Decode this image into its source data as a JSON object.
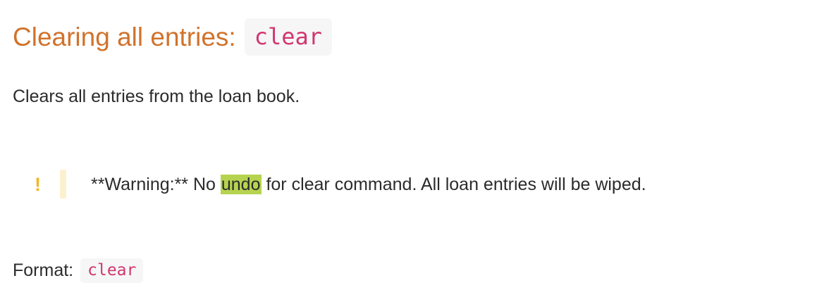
{
  "section": {
    "heading_text": "Clearing all entries:",
    "heading_code": "clear",
    "description": "Clears all entries from the loan book."
  },
  "warning": {
    "icon": "!",
    "icon_name": "exclamation-icon",
    "text_before": "**Warning:** No ",
    "highlighted": "undo",
    "text_after": " for clear command. All loan entries will be wiped."
  },
  "format": {
    "label": "Format:",
    "code": "clear"
  },
  "colors": {
    "heading": "#d0732c",
    "code": "#d1366f",
    "code_background": "#f6f6f6",
    "warning_icon": "#f3b624",
    "warning_bar": "#fcf1cf",
    "highlight": "#b6d350",
    "body_text": "#2b2b2b"
  }
}
